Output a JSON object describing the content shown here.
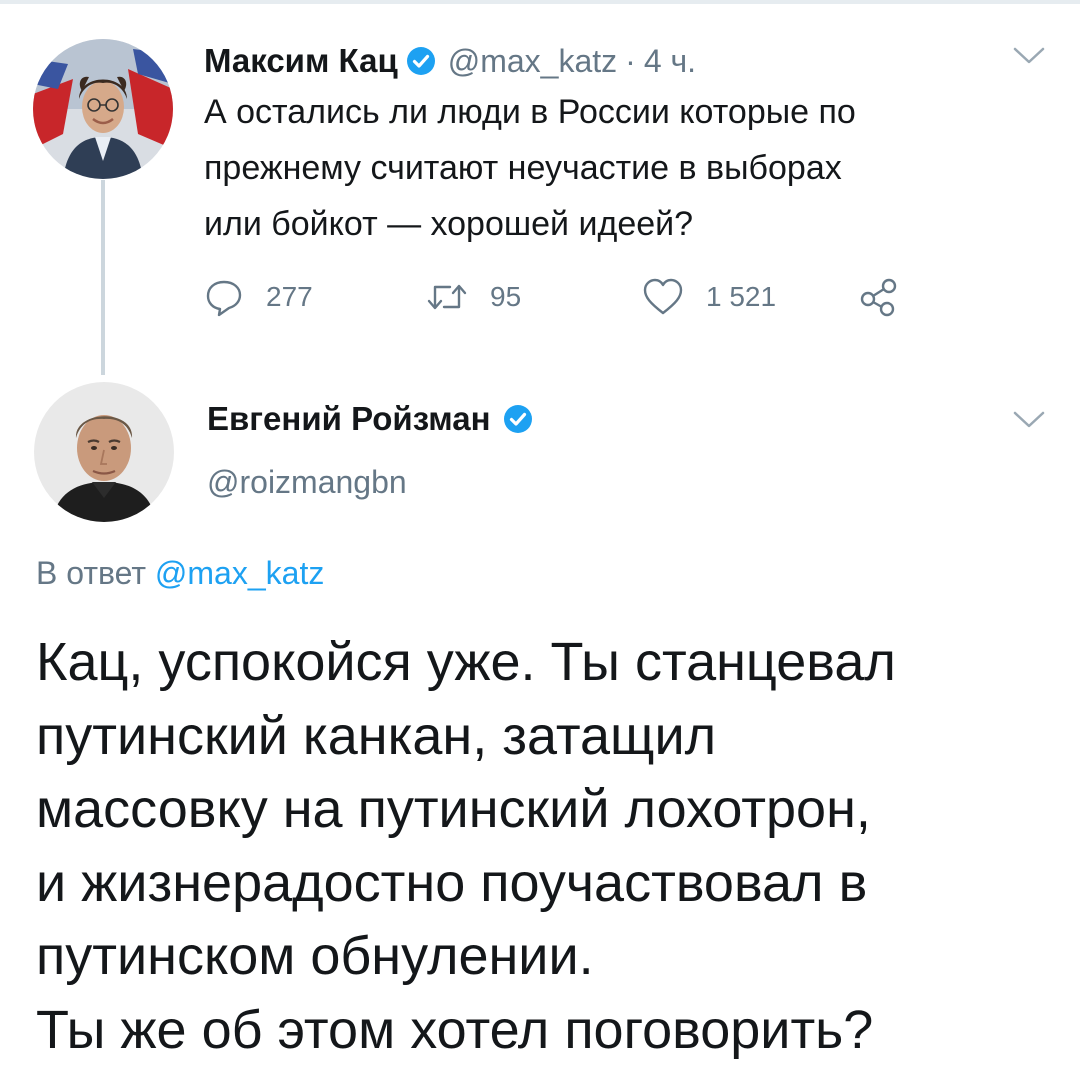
{
  "parent_tweet": {
    "author_name": "Максим Кац",
    "handle": "@max_katz",
    "separator": "·",
    "time": "4 ч.",
    "text": "А остались ли люди в России которые по\nпрежнему считают неучастие в выборах\nили бойкот — хорошей идеей?",
    "replies": "277",
    "retweets": "95",
    "likes": "1 521",
    "verified": true
  },
  "reply_tweet": {
    "author_name": "Евгений Ройзман",
    "handle": "@roizmangbn",
    "reply_prefix": "В ответ",
    "reply_mention": "@max_katz",
    "text": "Кац, успокойся уже. Ты станцевал\nпутинский канкан, затащил\nмассовку на путинский лохотрон,\nи жизнерадостно поучаствовал в\nпутинском обнулении.\nТы же об этом хотел поговорить?",
    "verified": true
  },
  "icons": {
    "reply": "reply-icon",
    "retweet": "retweet-icon",
    "like": "heart-icon",
    "share": "share-icon",
    "menu": "chevron-down-icon",
    "verified": "verified-badge-icon"
  },
  "colors": {
    "verified": "#1da1f2",
    "mention": "#1da1f2",
    "secondary_text": "#657786",
    "thread_line": "#ccd6dd",
    "text": "#14171a"
  }
}
